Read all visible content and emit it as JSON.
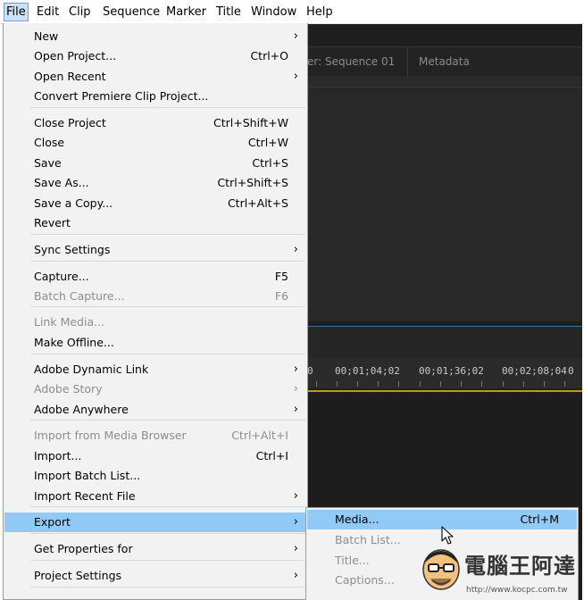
{
  "menubar": {
    "items": [
      "File",
      "Edit",
      "Clip",
      "Sequence",
      "Marker",
      "Title",
      "Window",
      "Help"
    ]
  },
  "app": {
    "tabs": [
      "er: Sequence 01",
      "Metadata"
    ],
    "timecodes": [
      "0",
      "00;01;04;02",
      "00;01;36;02",
      "00;02;08;04",
      "0"
    ]
  },
  "file_menu": {
    "items": [
      {
        "label": "New",
        "shortcut": "",
        "submenu": true,
        "disabled": false
      },
      {
        "label": "Open Project...",
        "shortcut": "Ctrl+O",
        "submenu": false,
        "disabled": false
      },
      {
        "label": "Open Recent",
        "shortcut": "",
        "submenu": true,
        "disabled": false
      },
      {
        "label": "Convert Premiere Clip Project...",
        "shortcut": "",
        "submenu": false,
        "disabled": false
      },
      {
        "label": "Close Project",
        "shortcut": "Ctrl+Shift+W",
        "submenu": false,
        "disabled": false
      },
      {
        "label": "Close",
        "shortcut": "Ctrl+W",
        "submenu": false,
        "disabled": false
      },
      {
        "label": "Save",
        "shortcut": "Ctrl+S",
        "submenu": false,
        "disabled": false
      },
      {
        "label": "Save As...",
        "shortcut": "Ctrl+Shift+S",
        "submenu": false,
        "disabled": false
      },
      {
        "label": "Save a Copy...",
        "shortcut": "Ctrl+Alt+S",
        "submenu": false,
        "disabled": false
      },
      {
        "label": "Revert",
        "shortcut": "",
        "submenu": false,
        "disabled": false
      },
      {
        "label": "Sync Settings",
        "shortcut": "",
        "submenu": true,
        "disabled": false
      },
      {
        "label": "Capture...",
        "shortcut": "F5",
        "submenu": false,
        "disabled": false
      },
      {
        "label": "Batch Capture...",
        "shortcut": "F6",
        "submenu": false,
        "disabled": true
      },
      {
        "label": "Link Media...",
        "shortcut": "",
        "submenu": false,
        "disabled": true
      },
      {
        "label": "Make Offline...",
        "shortcut": "",
        "submenu": false,
        "disabled": false
      },
      {
        "label": "Adobe Dynamic Link",
        "shortcut": "",
        "submenu": true,
        "disabled": false
      },
      {
        "label": "Adobe Story",
        "shortcut": "",
        "submenu": true,
        "disabled": true
      },
      {
        "label": "Adobe Anywhere",
        "shortcut": "",
        "submenu": true,
        "disabled": false
      },
      {
        "label": "Import from Media Browser",
        "shortcut": "Ctrl+Alt+I",
        "submenu": false,
        "disabled": true
      },
      {
        "label": "Import...",
        "shortcut": "Ctrl+I",
        "submenu": false,
        "disabled": false
      },
      {
        "label": "Import Batch List...",
        "shortcut": "",
        "submenu": false,
        "disabled": false
      },
      {
        "label": "Import Recent File",
        "shortcut": "",
        "submenu": true,
        "disabled": false
      },
      {
        "label": "Export",
        "shortcut": "",
        "submenu": true,
        "disabled": false,
        "highlighted": true
      },
      {
        "label": "Get Properties for",
        "shortcut": "",
        "submenu": true,
        "disabled": false
      },
      {
        "label": "Project Settings",
        "shortcut": "",
        "submenu": true,
        "disabled": false
      }
    ]
  },
  "export_submenu": {
    "items": [
      {
        "label": "Media...",
        "shortcut": "Ctrl+M",
        "disabled": false,
        "highlighted": true
      },
      {
        "label": "Batch List...",
        "shortcut": "",
        "disabled": true
      },
      {
        "label": "Title...",
        "shortcut": "",
        "disabled": true
      },
      {
        "label": "Captions...",
        "shortcut": "",
        "disabled": true
      }
    ]
  },
  "icons": {
    "submenu_arrow": "chevron-right-icon",
    "cursor": "mouse-pointer-icon"
  },
  "colors": {
    "highlight": "#91c9f7",
    "menu_bg": "#f2f2f2",
    "app_bg": "#1f1f1f",
    "timeline_accent": "#b99a1c"
  },
  "watermark": {
    "text": "電腦王阿達",
    "url": "http://www.kocpc.com.tw"
  }
}
